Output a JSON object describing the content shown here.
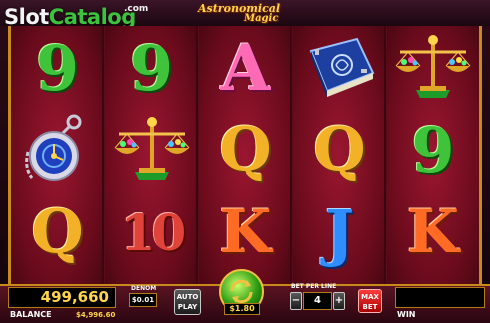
{
  "branding": {
    "site_word1": "Slot",
    "site_word2": "Catalog",
    "site_com": ".com"
  },
  "game": {
    "title_line1": "Astronomical",
    "title_line2": "Magic"
  },
  "reels": [
    [
      "9",
      "pocket-watch-symbol",
      "Q"
    ],
    [
      "9",
      "golden-scales-symbol",
      "10"
    ],
    [
      "A",
      "Q",
      "K"
    ],
    [
      "spell-book-symbol",
      "Q",
      "J"
    ],
    [
      "golden-scales-symbol",
      "9",
      "K"
    ]
  ],
  "panel": {
    "balance_value": "499,660",
    "balance_label": "BALANCE",
    "balance_cash": "$4,996.60",
    "denom_label": "DENOM",
    "denom_value": "$0.01",
    "autoplay_line1": "AUTO",
    "autoplay_line2": "PLAY",
    "bet_total": "$1.80",
    "bet_per_line_label": "BET PER LINE",
    "bet_per_line_value": "4",
    "maxbet_line1": "MAX",
    "maxbet_line2": "BET",
    "win_label": "WIN",
    "win_value": ""
  },
  "colors": {
    "accent_gold": "#c98a1c",
    "reel_red": "#9b1630",
    "spin_green": "#2e9b12"
  },
  "icons": {
    "spin": "refresh-arrows-icon",
    "decrease": "minus-icon",
    "increase": "plus-icon"
  }
}
